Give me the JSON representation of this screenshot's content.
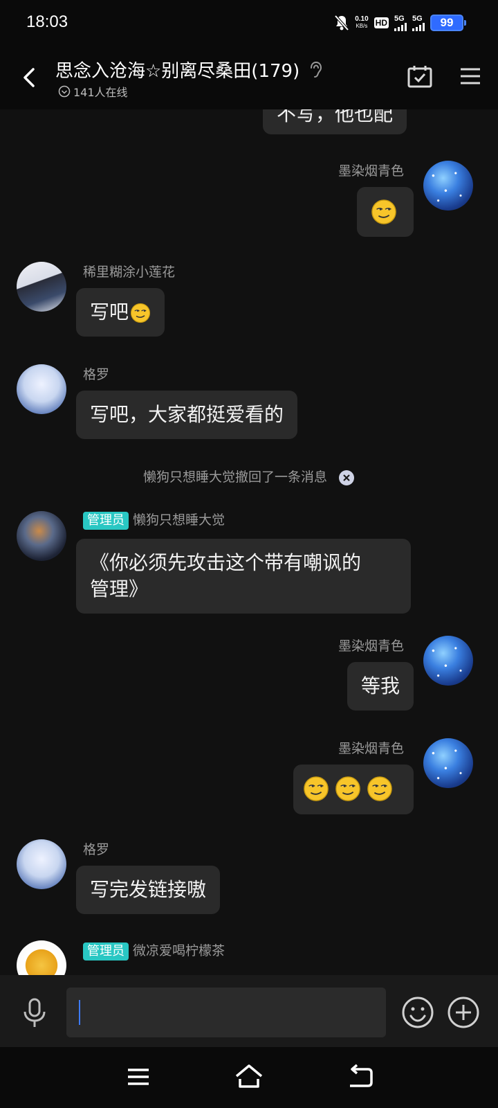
{
  "status_bar": {
    "time": "18:03",
    "net_speed_value": "0.10",
    "net_speed_unit": "KB/s",
    "hd_label": "HD",
    "sim1_label": "5G",
    "sim2_label": "5G",
    "battery": "99",
    "battery_color": "#2f6bff"
  },
  "header": {
    "title": "思念入沧海☆别离尽桑田(179)",
    "online": "141人在线"
  },
  "messages": [
    {
      "partial_text": "不写，他也配"
    },
    {
      "sender": "墨染烟青色",
      "emoji_count": 1
    },
    {
      "sender": "稀里糊涂小莲花",
      "text": "写吧"
    },
    {
      "sender": "格罗",
      "text": "写吧，大家都挺爱看的"
    },
    {
      "sender": "墨染烟青色",
      "text": "等我"
    },
    {
      "sender": "墨染烟青色",
      "emoji_count": 3
    },
    {
      "sender": "格罗",
      "text": "写完发链接嗷"
    }
  ],
  "system_notice": "懒狗只想睡大觉撤回了一条消息",
  "admin_message": {
    "badge": "管理员",
    "sender": "懒狗只想睡大觉",
    "line1": "《你必须先攻击这个带有嘲讽的",
    "line2": "管理》"
  },
  "admin_message_2": {
    "badge": "管理员",
    "sender": "微凉爱喝柠檬茶"
  },
  "input": {
    "value": "",
    "caret_color": "#3d7bff"
  },
  "colors": {
    "admin_badge": "#29c7c3",
    "bubble": "#2a2a2a",
    "background": "#111111"
  }
}
